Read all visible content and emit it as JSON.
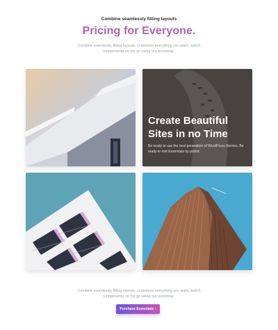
{
  "header": {
    "eyebrow": "Combine seamlessly fitting layouts",
    "title": "Pricing for Everyone.",
    "subtitle": "Combine seamlessly fitting layouts, customize everything you want, switch components on the go using our bootstrap."
  },
  "feature_card": {
    "heading_line1": "Create Beautiful",
    "heading_line2": "Sites in no Time",
    "description": "Be ready to use the next generation of WordPress themes. Be ready to met Essentials by pixfort."
  },
  "footer": {
    "text": "Combine seamlessly fitting layouts, customize everything you want, switch components on the go using our bootstrap.",
    "cta_label": "Purchase Essentials",
    "cta_arrow": "›"
  },
  "colors": {
    "title": "#b062b3",
    "cta_start": "#6a5bd6",
    "cta_end": "#c654b5"
  }
}
